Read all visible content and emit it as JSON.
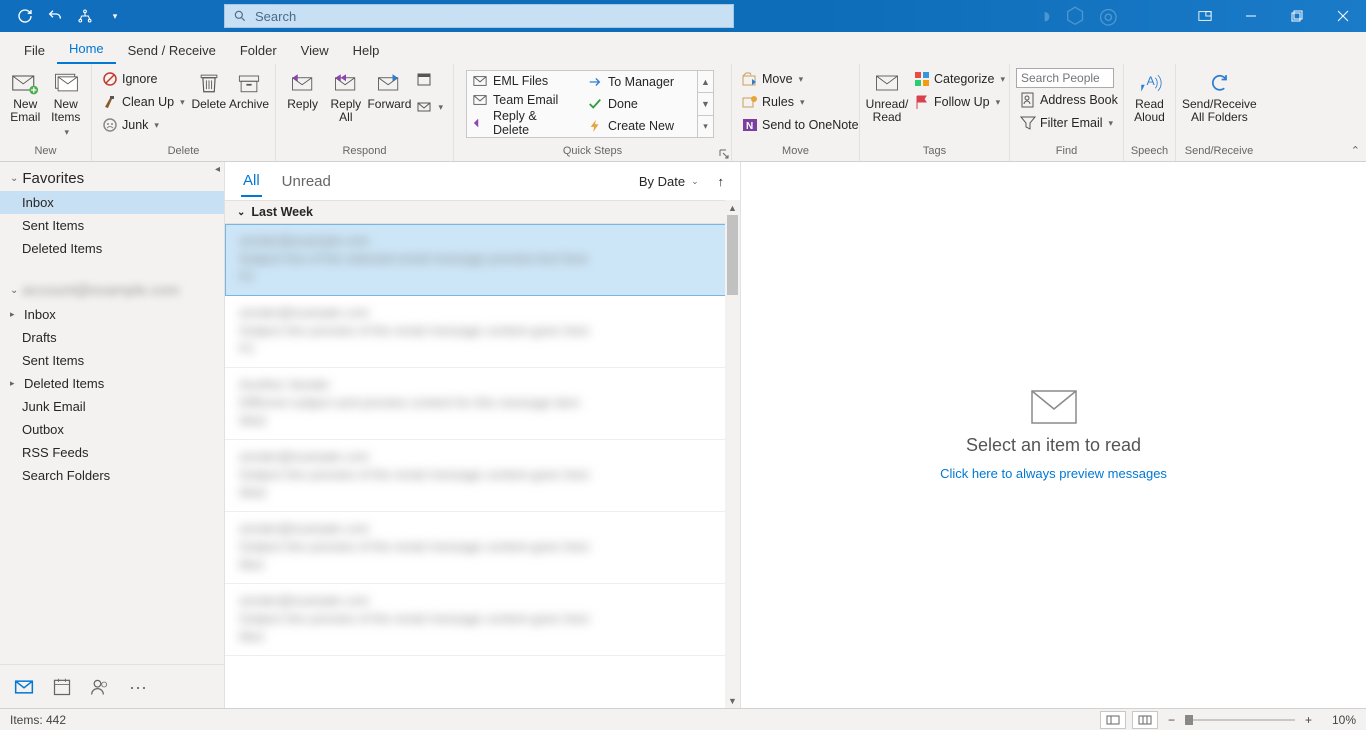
{
  "search": {
    "placeholder": "Search"
  },
  "menu_tabs": [
    "File",
    "Home",
    "Send / Receive",
    "Folder",
    "View",
    "Help"
  ],
  "active_menu_tab": "Home",
  "ribbon": {
    "new_group": {
      "label": "New",
      "new_email": "New\nEmail",
      "new_items": "New\nItems"
    },
    "delete_group": {
      "label": "Delete",
      "ignore": "Ignore",
      "clean_up": "Clean Up",
      "junk": "Junk",
      "delete": "Delete",
      "archive": "Archive"
    },
    "respond_group": {
      "label": "Respond",
      "reply": "Reply",
      "reply_all": "Reply\nAll",
      "forward": "Forward"
    },
    "quick_steps_group": {
      "label": "Quick Steps",
      "eml_files": "EML Files",
      "team_email": "Team Email",
      "reply_delete": "Reply & Delete",
      "to_manager": "To Manager",
      "done": "Done",
      "create_new": "Create New"
    },
    "move_group": {
      "label": "Move",
      "move": "Move",
      "rules": "Rules",
      "onenote": "Send to OneNote"
    },
    "tags_group": {
      "label": "Tags",
      "unread_read": "Unread/\nRead",
      "categorize": "Categorize",
      "follow_up": "Follow Up"
    },
    "find_group": {
      "label": "Find",
      "search_people_placeholder": "Search People",
      "address_book": "Address Book",
      "filter_email": "Filter Email"
    },
    "speech_group": {
      "label": "Speech",
      "read_aloud": "Read\nAloud"
    },
    "sendreceive_group": {
      "label": "Send/Receive",
      "all_folders": "Send/Receive\nAll Folders"
    }
  },
  "folders": {
    "favorites_label": "Favorites",
    "favorites": [
      "Inbox",
      "Sent Items",
      "Deleted Items"
    ],
    "account_items": [
      "Inbox",
      "Drafts",
      "Sent Items",
      "Deleted Items",
      "Junk Email",
      "Outbox",
      "RSS Feeds",
      "Search Folders"
    ]
  },
  "message_list": {
    "tabs": {
      "all": "All",
      "unread": "Unread"
    },
    "sort_label": "By Date",
    "group_header": "Last Week"
  },
  "reading_pane": {
    "empty_title": "Select an item to read",
    "preview_link": "Click here to always preview messages"
  },
  "status_bar": {
    "items": "Items: 442",
    "zoom": "10%"
  }
}
